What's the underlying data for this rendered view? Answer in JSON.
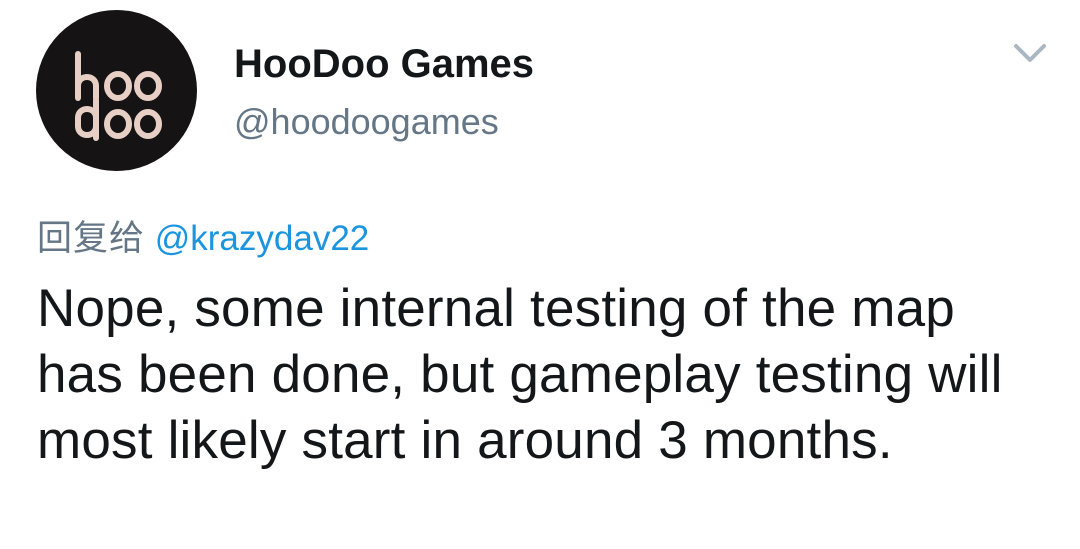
{
  "author": {
    "display_name": "HooDoo Games",
    "handle": "@hoodoogames",
    "avatar_text": "hoo doo"
  },
  "menu": {
    "icon": "chevron-down-icon"
  },
  "reply": {
    "prefix": "回复给",
    "to_handle": "@krazydav22"
  },
  "tweet": {
    "text": "Nope, some internal testing of the map has been done, but gameplay testing will most likely start in around 3 months."
  },
  "colors": {
    "name": "#14171a",
    "secondary": "#657786",
    "link": "#1b95e0",
    "avatar_bg": "#151313",
    "avatar_text": "#e8cfc6"
  }
}
